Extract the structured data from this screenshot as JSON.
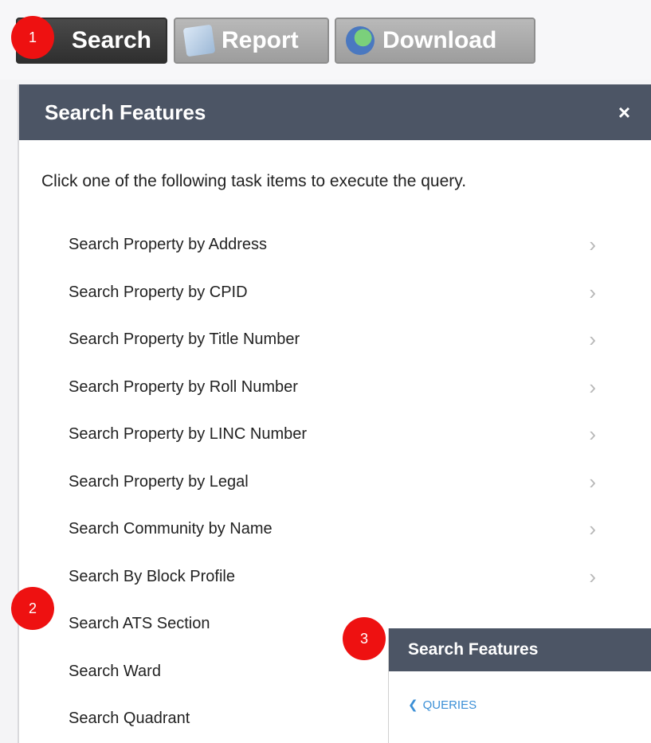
{
  "toolbar": {
    "search_label": "Search",
    "report_label": "Report",
    "download_label": "Download"
  },
  "markers": [
    "1",
    "2",
    "3"
  ],
  "panel": {
    "title": "Search Features",
    "close_glyph": "×",
    "instructions": "Click one of the following task items to execute the query.",
    "items": [
      {
        "label": "Search Property by Address"
      },
      {
        "label": "Search Property by CPID"
      },
      {
        "label": "Search Property by Title Number"
      },
      {
        "label": "Search Property by Roll Number"
      },
      {
        "label": "Search Property by LINC Number"
      },
      {
        "label": "Search Property by Legal"
      },
      {
        "label": "Search Community by Name"
      },
      {
        "label": "Search By Block Profile"
      },
      {
        "label": "Search ATS Section"
      },
      {
        "label": "Search Ward"
      },
      {
        "label": "Search Quadrant"
      }
    ],
    "chevron_glyph": "›"
  },
  "sub_panel": {
    "title": "Search Features",
    "back_glyph": "❮",
    "queries_label": "QUERIES"
  },
  "colors": {
    "header_bg": "#4c5565",
    "marker": "#ee1111",
    "link": "#3b8fd6"
  },
  "icons": [
    "report-icon",
    "download-icon",
    "close-icon",
    "chevron-right-icon",
    "chevron-left-icon"
  ]
}
